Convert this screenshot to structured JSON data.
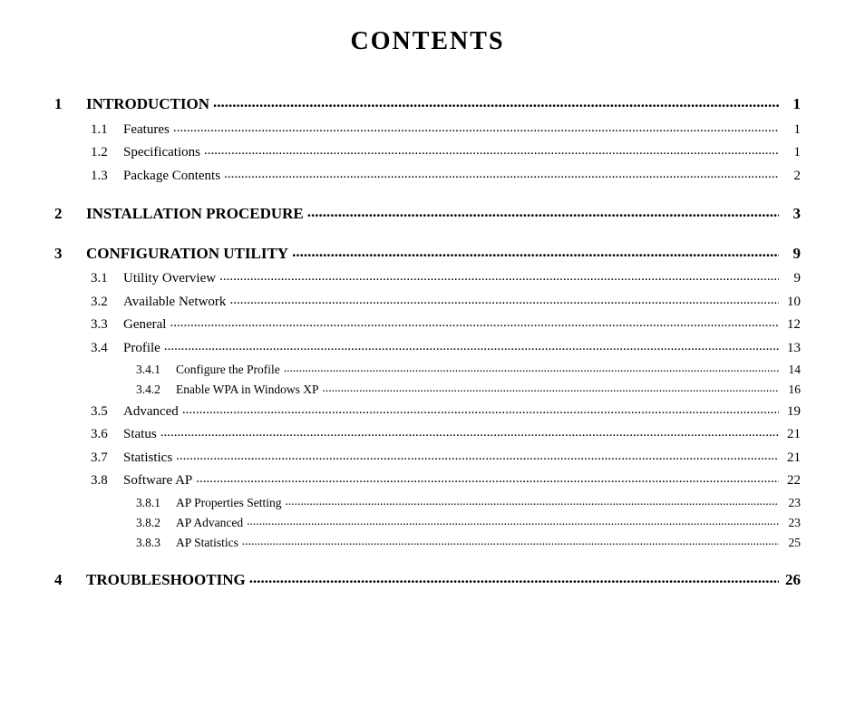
{
  "page": {
    "title": "CONTENTS"
  },
  "toc": [
    {
      "level": 1,
      "num": "1",
      "label": "INTRODUCTION",
      "page": "1"
    },
    {
      "level": 2,
      "num": "1.1",
      "label": "Features",
      "page": "1"
    },
    {
      "level": 2,
      "num": "1.2",
      "label": "Specifications",
      "page": "1"
    },
    {
      "level": 2,
      "num": "1.3",
      "label": "Package Contents",
      "page": "2"
    },
    {
      "level": 1,
      "num": "2",
      "label": "INSTALLATION PROCEDURE",
      "page": "3"
    },
    {
      "level": 1,
      "num": "3",
      "label": "CONFIGURATION UTILITY",
      "page": "9"
    },
    {
      "level": 2,
      "num": "3.1",
      "label": "Utility Overview",
      "page": "9"
    },
    {
      "level": 2,
      "num": "3.2",
      "label": "Available Network",
      "page": "10"
    },
    {
      "level": 2,
      "num": "3.3",
      "label": "General",
      "page": "12"
    },
    {
      "level": 2,
      "num": "3.4",
      "label": "Profile",
      "page": "13"
    },
    {
      "level": 3,
      "num": "3.4.1",
      "label": "Configure the Profile",
      "page": "14"
    },
    {
      "level": 3,
      "num": "3.4.2",
      "label": "Enable WPA in Windows XP",
      "page": "16"
    },
    {
      "level": 2,
      "num": "3.5",
      "label": "Advanced",
      "page": "19"
    },
    {
      "level": 2,
      "num": "3.6",
      "label": "Status",
      "page": "21"
    },
    {
      "level": 2,
      "num": "3.7",
      "label": "Statistics",
      "page": "21"
    },
    {
      "level": 2,
      "num": "3.8",
      "label": "Software AP",
      "page": "22"
    },
    {
      "level": 3,
      "num": "3.8.1",
      "label": "AP Properties Setting",
      "page": "23"
    },
    {
      "level": 3,
      "num": "3.8.2",
      "label": "AP Advanced",
      "page": "23"
    },
    {
      "level": 3,
      "num": "3.8.3",
      "label": "AP Statistics",
      "page": "25"
    },
    {
      "level": 1,
      "num": "4",
      "label": "TROUBLESHOOTING",
      "page": "26"
    }
  ]
}
